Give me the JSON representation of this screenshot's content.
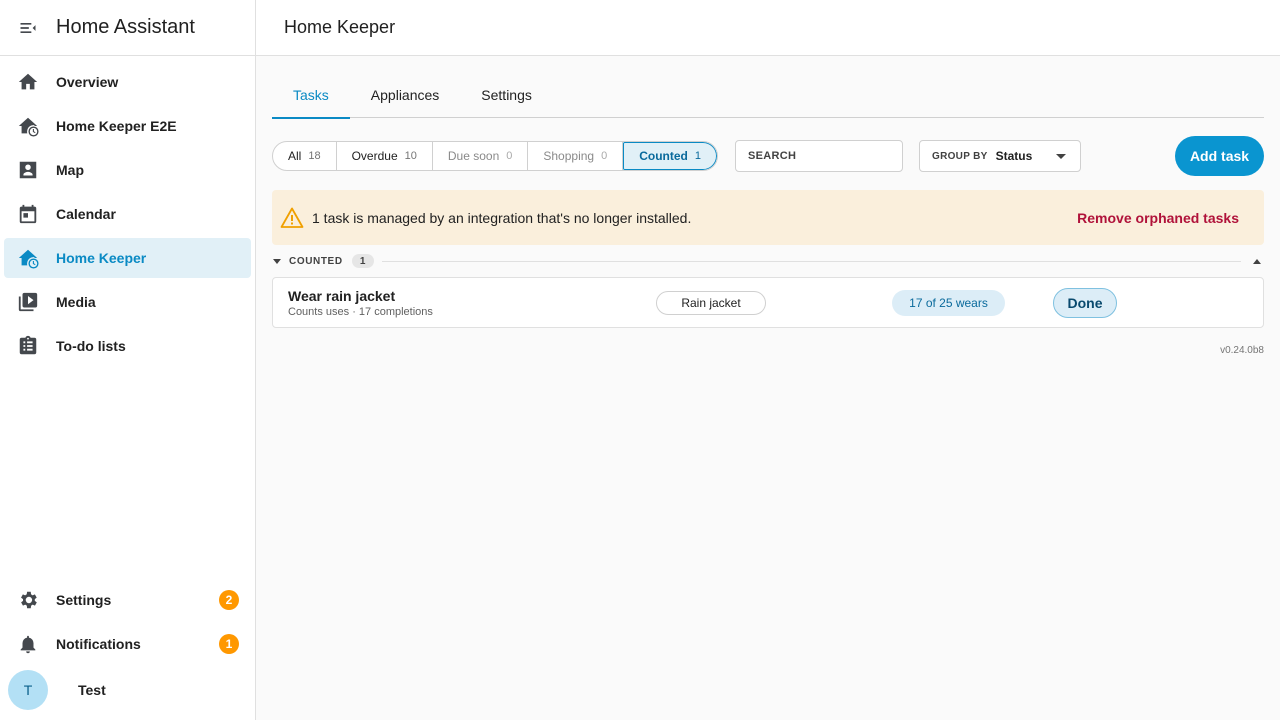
{
  "sidebar": {
    "title": "Home Assistant",
    "menu_icon": "menu-collapse-icon",
    "items": [
      {
        "label": "Overview",
        "icon": "home-icon"
      },
      {
        "label": "Home Keeper E2E",
        "icon": "home-clock-icon"
      },
      {
        "label": "Map",
        "icon": "map-person-icon"
      },
      {
        "label": "Calendar",
        "icon": "calendar-icon"
      },
      {
        "label": "Home Keeper",
        "icon": "home-clock-icon",
        "active": true
      },
      {
        "label": "Media",
        "icon": "media-play-icon"
      },
      {
        "label": "To-do lists",
        "icon": "clipboard-list-icon"
      }
    ],
    "settings": {
      "label": "Settings",
      "badge": "2"
    },
    "notifications": {
      "label": "Notifications",
      "badge": "1"
    },
    "user": {
      "initial": "T",
      "name": "Test"
    }
  },
  "topbar": {
    "title": "Home Keeper"
  },
  "tabs": [
    {
      "label": "Tasks",
      "active": true
    },
    {
      "label": "Appliances"
    },
    {
      "label": "Settings"
    }
  ],
  "filters": [
    {
      "label": "All",
      "count": "18"
    },
    {
      "label": "Overdue",
      "count": "10"
    },
    {
      "label": "Due soon",
      "count": "0"
    },
    {
      "label": "Shopping",
      "count": "0"
    },
    {
      "label": "Counted",
      "count": "1",
      "active": true
    }
  ],
  "search": {
    "placeholder": "SEARCH"
  },
  "group_by": {
    "label": "GROUP BY",
    "value": "Status"
  },
  "add_task": {
    "label": "Add task"
  },
  "alert": {
    "message": "1 task is managed by an integration that's no longer installed.",
    "action": "Remove orphaned tasks"
  },
  "group": {
    "label": "COUNTED",
    "count": "1"
  },
  "task": {
    "title": "Wear rain jacket",
    "subtitle": "Counts uses · 17 completions",
    "appliance": "Rain jacket",
    "progress": "17 of 25 wears",
    "done_label": "Done"
  },
  "version": "v0.24.0b8",
  "colors": {
    "accent": "#0a8ac4",
    "button": "#0a95d0",
    "badge": "#ff9800",
    "alert_bg": "#faefdc",
    "alert_action": "#b0123a",
    "warning": "#f0a000"
  }
}
